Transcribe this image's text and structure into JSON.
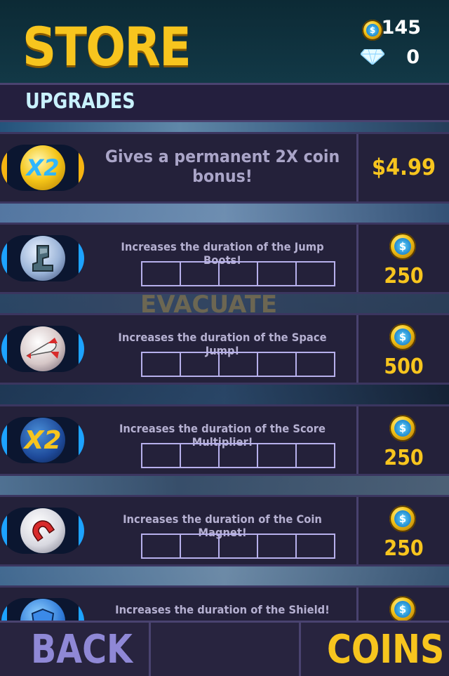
{
  "header": {
    "title": "STORE",
    "coins_count": "145",
    "gems_count": "0",
    "coin_icon": "coin-icon",
    "gem_icon": "diamond-icon"
  },
  "section": {
    "label": "UPGRADES"
  },
  "items": [
    {
      "icon": "x2-coin-icon",
      "description": "Gives a permanent 2X coin bonus!",
      "price": "$4.99",
      "price_type": "cash"
    },
    {
      "icon": "jump-boots-icon",
      "description": "Increases the duration of the Jump Boots!",
      "price": "250",
      "price_type": "coins",
      "level": 0,
      "max_level": 5
    },
    {
      "icon": "space-jump-rocket-icon",
      "description": "Increases the duration of the Space Jump!",
      "price": "500",
      "price_type": "coins",
      "level": 0,
      "max_level": 5
    },
    {
      "icon": "score-multiplier-x2-icon",
      "description": "Increases the duration of the Score Multiplier!",
      "price": "250",
      "price_type": "coins",
      "level": 0,
      "max_level": 5
    },
    {
      "icon": "coin-magnet-icon",
      "description": "Increases the duration of the Coin Magnet!",
      "price": "250",
      "price_type": "coins",
      "level": 0,
      "max_level": 5
    },
    {
      "icon": "shield-icon",
      "description": "Increases the duration of the Shield!",
      "price_type": "coins"
    }
  ],
  "icon_text": {
    "x2": "X2"
  },
  "background_text": {
    "evacuate": "EVACUATE"
  },
  "footer": {
    "back_label": "BACK",
    "coins_label": "COINS"
  },
  "colors": {
    "accent_gold": "#f7c51e",
    "panel": "#24213a",
    "back_text": "#8f88d6",
    "section_text": "#c9f2ff"
  }
}
